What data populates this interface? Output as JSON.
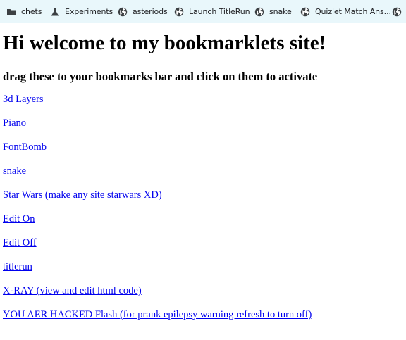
{
  "bookmarks_bar": {
    "items": [
      {
        "label": "chets",
        "icon": "folder-icon"
      },
      {
        "label": "Experiments",
        "icon": "flask-icon"
      },
      {
        "label": "asteriods",
        "icon": "globe-icon"
      },
      {
        "label": "Launch TitleRun",
        "icon": "globe-icon"
      },
      {
        "label": "snake",
        "icon": "globe-icon"
      },
      {
        "label": "Quizlet Match Ans...",
        "icon": "globe-icon"
      },
      {
        "label": "",
        "icon": "globe-icon"
      }
    ],
    "background": "#e9f7fb"
  },
  "page": {
    "title": "Hi welcome to my bookmarklets site!",
    "subtitle": "drag these to your bookmarks bar and click on them to activate",
    "link_color": "#0000ee",
    "links": [
      {
        "label": "3d Layers"
      },
      {
        "label": "Piano"
      },
      {
        "label": "FontBomb"
      },
      {
        "label": "snake"
      },
      {
        "label": "Star Wars (make any site starwars XD)"
      },
      {
        "label": "Edit On"
      },
      {
        "label": "Edit Off"
      },
      {
        "label": "titlerun"
      },
      {
        "label": "X-RAY (view and edit html code)"
      },
      {
        "label": "YOU AER HACKED Flash (for prank epilepsy warning refresh to turn off)"
      }
    ]
  }
}
